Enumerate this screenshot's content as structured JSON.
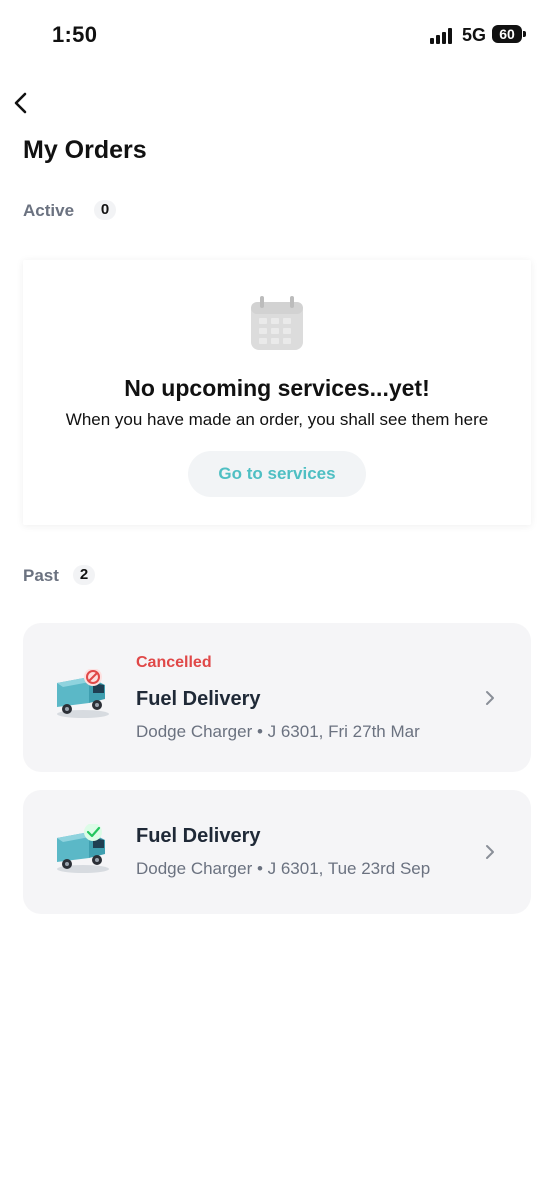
{
  "status_bar": {
    "time": "1:50",
    "network": "5G",
    "battery": "60"
  },
  "header": {
    "title": "My Orders"
  },
  "active": {
    "label": "Active",
    "count": "0",
    "empty_title": "No upcoming services...yet!",
    "empty_subtitle": "When you have made an order, you shall see them here",
    "cta_label": "Go to services"
  },
  "past": {
    "label": "Past",
    "count": "2",
    "orders": [
      {
        "status": "Cancelled",
        "title": "Fuel Delivery",
        "subtitle": "Dodge Charger • J 6301, Fri 27th Mar",
        "badge": "cancelled"
      },
      {
        "status": "",
        "title": "Fuel Delivery",
        "subtitle": "Dodge Charger • J 6301, Tue 23rd Sep",
        "badge": "completed"
      }
    ]
  },
  "colors": {
    "accent": "#4fbfc3",
    "cancelled": "#e04848",
    "completed": "#22c55e"
  }
}
